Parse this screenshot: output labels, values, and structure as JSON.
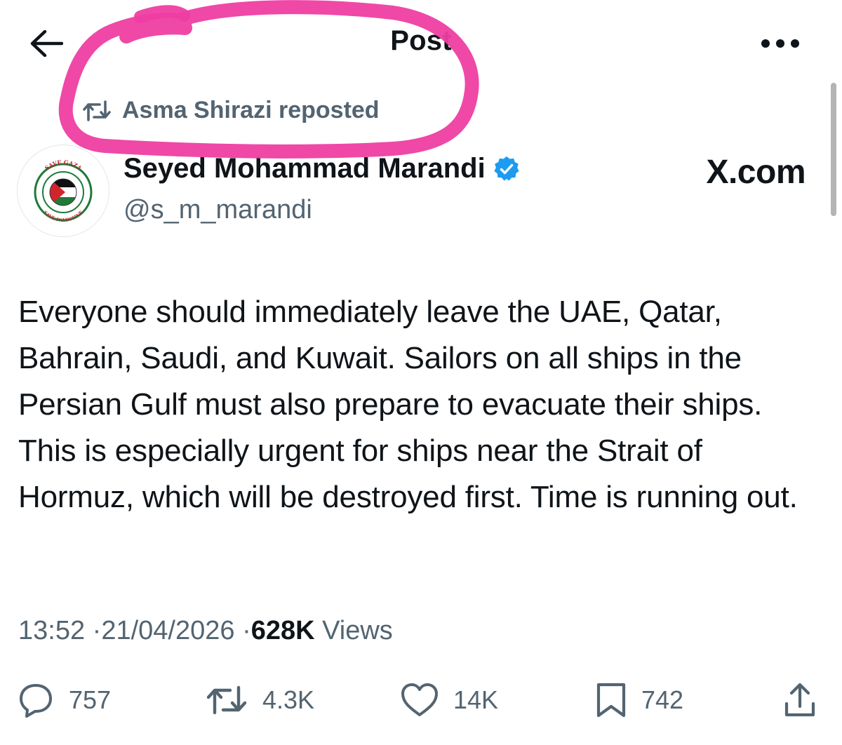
{
  "header": {
    "title": "Post",
    "back_icon": "arrow-left-icon",
    "more_icon": "more-horizontal-icon"
  },
  "repost": {
    "icon": "repost-icon",
    "text": "Asma Shirazi reposted"
  },
  "author": {
    "name": "Seyed Mohammad Marandi",
    "handle": "@s_m_marandi",
    "verified_icon": "verified-badge-icon",
    "avatar_icon": "save-gaza-badge-avatar",
    "avatar_text_top": "SAVE GAZA",
    "avatar_text_bottom": "SAVE PALESTINE"
  },
  "watermark": "X.com",
  "post": {
    "text": "Everyone should immediately leave the UAE, Qatar, Bahrain, Saudi, and Kuwait. Sailors on all ships in the Persian Gulf must also prepare to evacuate their ships. This is especially urgent for ships near the Strait of Hormuz, which will be destroyed first. Time is running out."
  },
  "meta": {
    "time": "13:52",
    "separator": "·",
    "date": "21/04/2026",
    "views_count": "628K",
    "views_label": "Views"
  },
  "actions": {
    "replies": "757",
    "reposts": "4.3K",
    "likes": "14K",
    "bookmarks": "742"
  },
  "colors": {
    "text_primary": "#0f1419",
    "text_secondary": "#536471",
    "verified_blue": "#1d9bf0",
    "annotation_pink": "#ee3ea2"
  }
}
